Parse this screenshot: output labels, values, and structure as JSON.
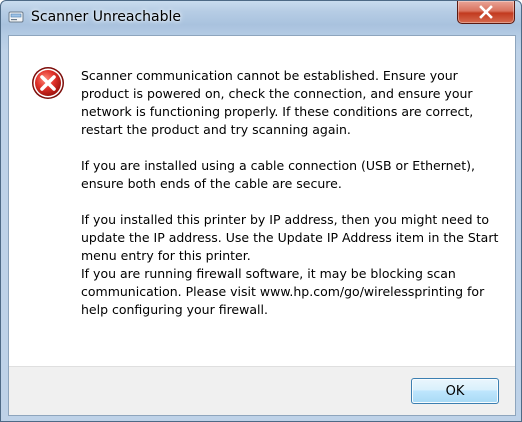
{
  "window": {
    "title": "Scanner Unreachable",
    "app_icon": "scanner-app-icon",
    "close_icon": "close-x-icon"
  },
  "message": {
    "icon": "error-icon",
    "paragraphs": [
      "Scanner communication cannot be established.  Ensure your product is powered on, check the connection, and ensure your network is functioning properly.  If these conditions are correct, restart the product and try scanning again.",
      "If you are installed using a cable connection (USB or Ethernet), ensure both ends of the cable are secure.",
      "If you installed this printer by IP address, then you might need to update the IP address.  Use the Update IP Address item in the Start menu entry for this printer.",
      "If you are running firewall software, it may be blocking scan communication.  Please visit www.hp.com/go/wirelessprinting for help configuring your firewall."
    ]
  },
  "buttons": {
    "ok_label": "OK"
  },
  "colors": {
    "title_bar": "#b7cde5",
    "close_button": "#c23a1f",
    "error_red": "#d11f1f",
    "ok_button_border": "#3c7fb1"
  }
}
